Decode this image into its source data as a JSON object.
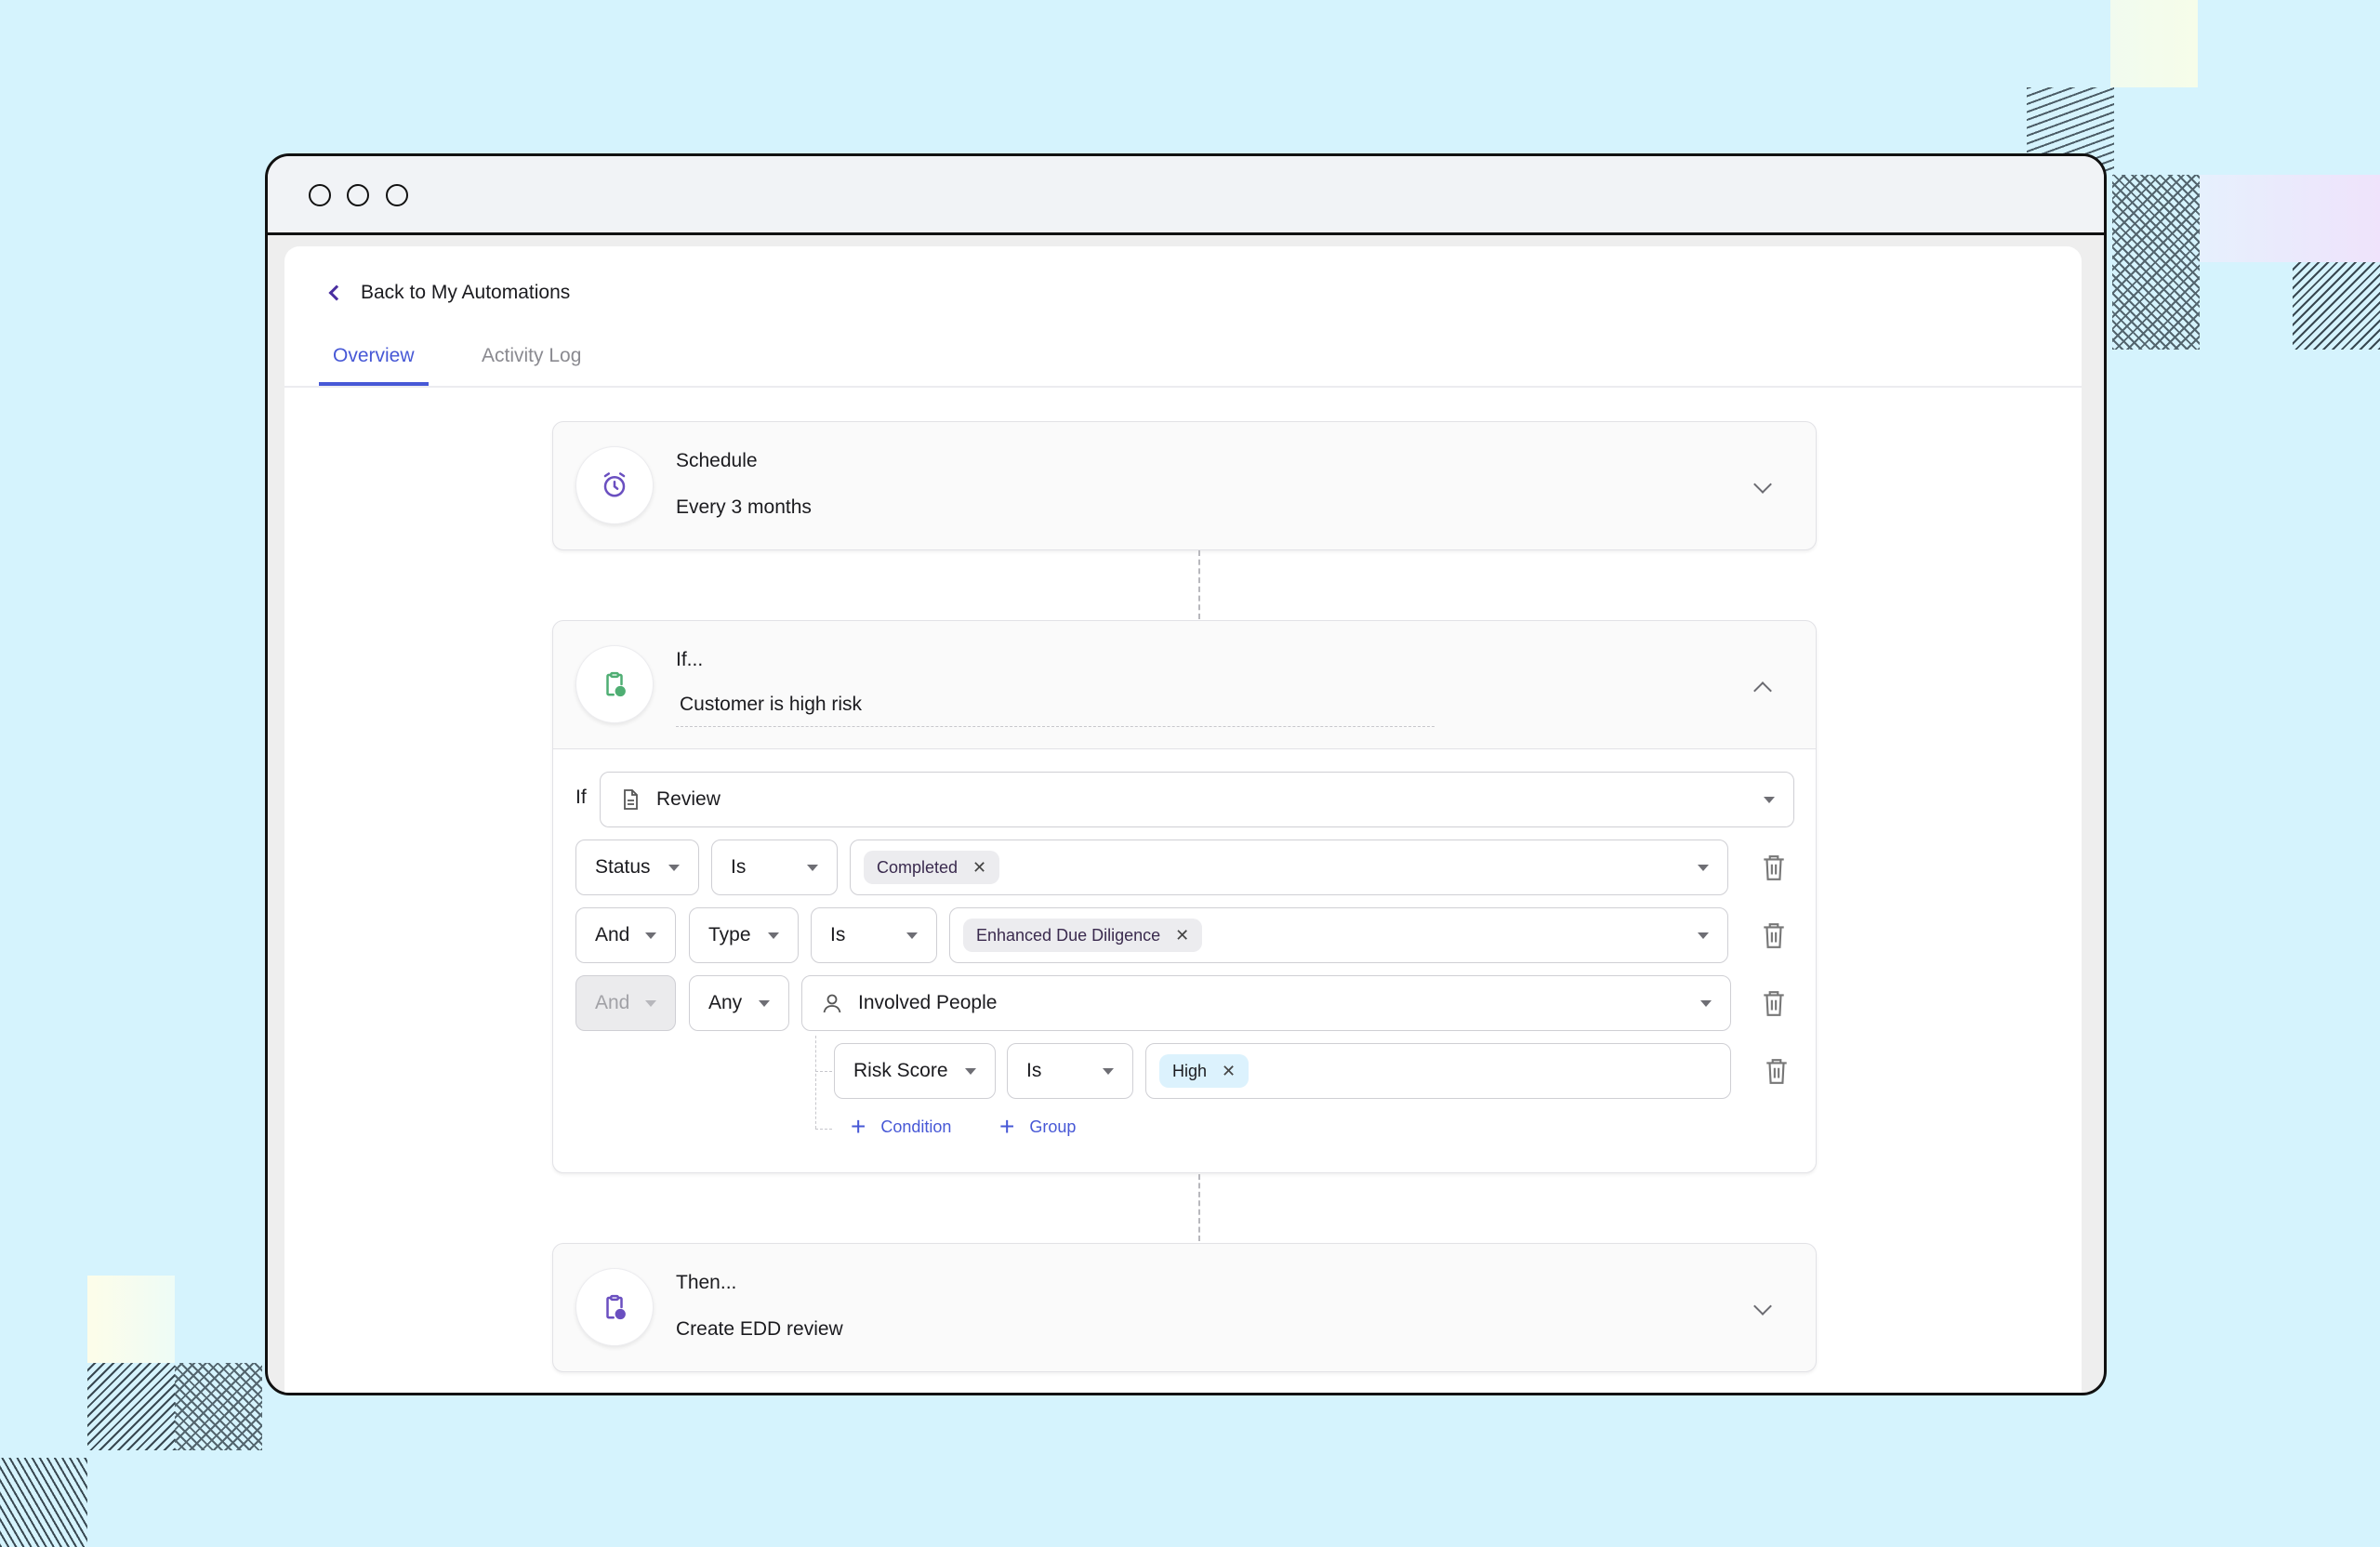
{
  "navigation": {
    "back_label": "Back to My Automations",
    "tabs": [
      {
        "label": "Overview",
        "active": true
      },
      {
        "label": "Activity Log",
        "active": false
      }
    ]
  },
  "schedule": {
    "title": "Schedule",
    "value": "Every 3 months",
    "icon": "alarm-clock-icon",
    "icon_color": "#6a4fc0",
    "expanded": false
  },
  "condition": {
    "title": "If...",
    "name": "Customer is high risk",
    "icon": "clipboard-clock-icon",
    "icon_color": "#4fae73",
    "expanded": true,
    "if_label": "If",
    "entity": "Review",
    "rows": [
      {
        "field": "Status",
        "operator": "Is",
        "values": [
          "Completed"
        ]
      },
      {
        "conjunction": "And",
        "field": "Type",
        "operator": "Is",
        "values": [
          "Enhanced Due Diligence"
        ]
      },
      {
        "conjunction": "And",
        "quantifier": "Any",
        "relation": "Involved People"
      }
    ],
    "nested_rows": [
      {
        "field": "Risk Score",
        "operator": "Is",
        "values": [
          "High"
        ]
      }
    ],
    "add_condition_label": "Condition",
    "add_group_label": "Group"
  },
  "action": {
    "title": "Then...",
    "value": "Create EDD review",
    "icon": "clipboard-clock-icon",
    "icon_color": "#6a4fc0",
    "expanded": false
  },
  "colors": {
    "accent": "#4758d6",
    "background": "#d5f3fd"
  }
}
